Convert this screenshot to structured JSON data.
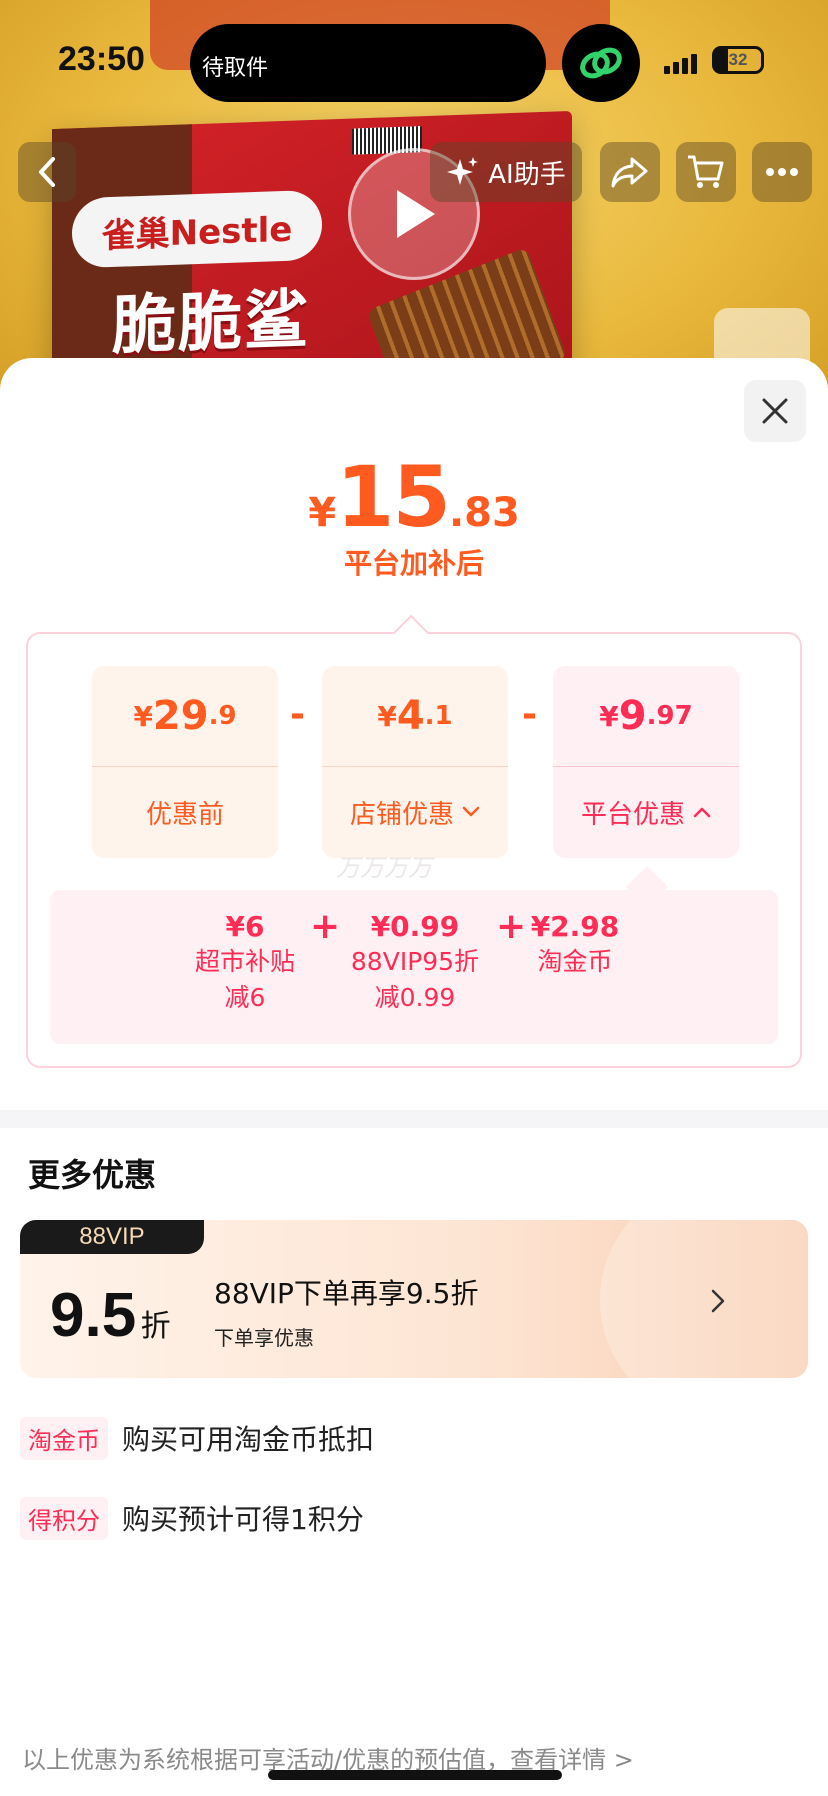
{
  "status_bar": {
    "time": "23:50",
    "island_text": "待取件",
    "battery": "32"
  },
  "nav": {
    "ai_label": "AI助手"
  },
  "product_bg": {
    "logo_text": "雀巢Nestle",
    "product_name": "脆脆鲨"
  },
  "price": {
    "currency": "¥",
    "integer": "15",
    "decimal": ".83",
    "label": "平台加补后"
  },
  "breakdown": {
    "items": [
      {
        "currency": "¥",
        "integer": "29",
        "decimal": ".9",
        "label": "优惠前"
      },
      {
        "currency": "¥",
        "integer": "4",
        "decimal": ".1",
        "label": "店铺优惠"
      },
      {
        "currency": "¥",
        "integer": "9",
        "decimal": ".97",
        "label": "平台优惠"
      }
    ],
    "operator": "-",
    "watermark": "万万万万"
  },
  "platform_detail": {
    "items": [
      {
        "value": "¥6",
        "name": "超市补贴",
        "note": "减6"
      },
      {
        "value": "¥0.99",
        "name": "88VIP95折",
        "note": "减0.99"
      },
      {
        "value": "¥2.98",
        "name": "淘金币",
        "note": ""
      }
    ],
    "operator": "+"
  },
  "more_offers": {
    "title": "更多优惠",
    "vip": {
      "tag": "88VIP",
      "discount": "9.5",
      "unit": "折",
      "title": "88VIP下单再享9.5折",
      "subtitle": "下单享优惠"
    },
    "perks": [
      {
        "badge": "淘金币",
        "text": "购买可用淘金币抵扣"
      },
      {
        "badge": "得积分",
        "text": "购买预计可得1积分"
      }
    ]
  },
  "footer": {
    "note": "以上优惠为系统根据可享活动/优惠的预估值，查看详情 >"
  },
  "colors": {
    "accent_orange": "#ff5a1f",
    "accent_pink": "#ff2d55"
  }
}
